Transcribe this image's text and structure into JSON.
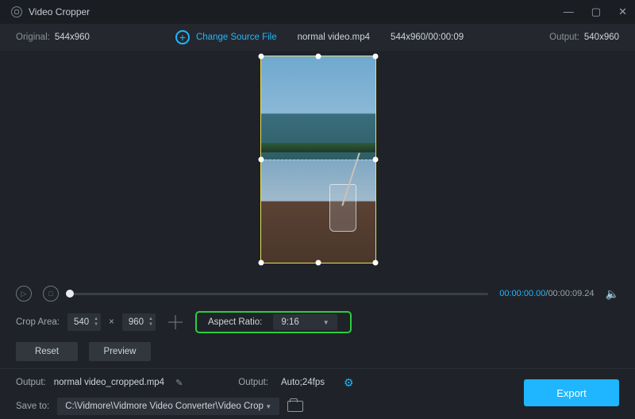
{
  "titlebar": {
    "app_name": "Video Cropper"
  },
  "infobar": {
    "original_label": "Original:",
    "original_dims": "544x960",
    "change_source_label": "Change Source File",
    "filename": "normal video.mp4",
    "dims_time": "544x960/00:00:09",
    "output_label": "Output:",
    "output_dims": "540x960"
  },
  "timeline": {
    "current": "00:00:00.00",
    "total": "00:00:09.24"
  },
  "crop": {
    "area_label": "Crop Area:",
    "width": "540",
    "height": "960",
    "times": "×",
    "aspect_label": "Aspect Ratio:",
    "aspect_value": "9:16"
  },
  "buttons": {
    "reset": "Reset",
    "preview": "Preview",
    "export": "Export"
  },
  "output": {
    "label": "Output:",
    "filename": "normal video_cropped.mp4",
    "format_label": "Output:",
    "format_value": "Auto;24fps"
  },
  "save": {
    "label": "Save to:",
    "path": "C:\\Vidmore\\Vidmore Video Converter\\Video Crop"
  }
}
